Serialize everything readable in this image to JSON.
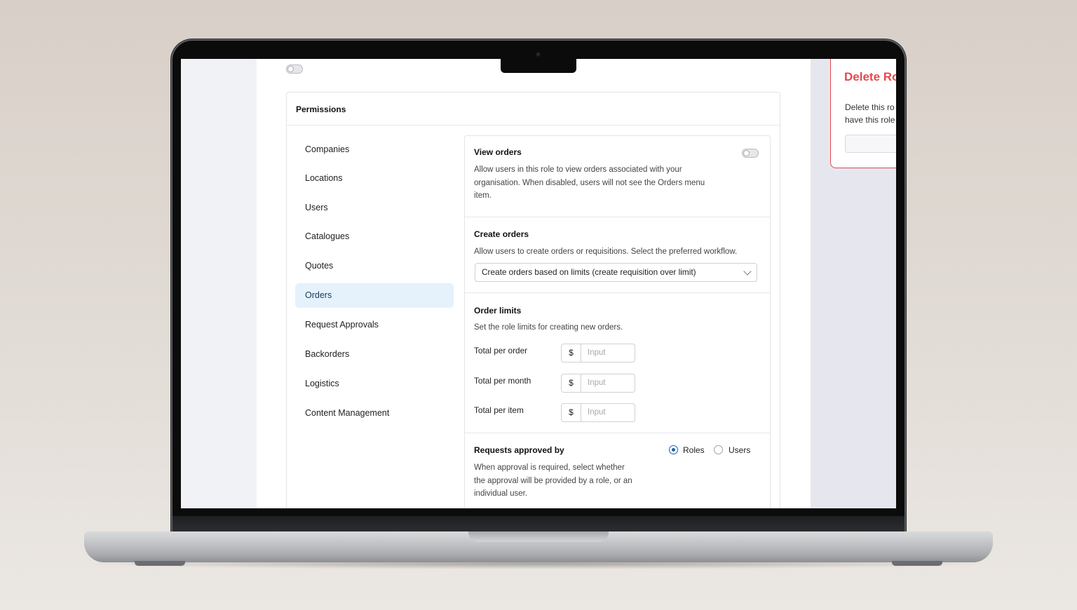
{
  "delete_panel": {
    "title": "Delete Ro",
    "text_line1": "Delete this ro",
    "text_line2": "have this role"
  },
  "permissions": {
    "title": "Permissions",
    "nav_items": [
      {
        "label": "Companies"
      },
      {
        "label": "Locations"
      },
      {
        "label": "Users"
      },
      {
        "label": "Catalogues"
      },
      {
        "label": "Quotes"
      },
      {
        "label": "Orders",
        "active": true
      },
      {
        "label": "Request Approvals"
      },
      {
        "label": "Backorders"
      },
      {
        "label": "Logistics"
      },
      {
        "label": "Content Management"
      }
    ]
  },
  "view_orders": {
    "title": "View orders",
    "enabled": false,
    "line1": "Allow users in this role to view orders associated with your",
    "line2": "organisation. When disabled, users will not see the Orders menu",
    "line3": "item."
  },
  "create_orders": {
    "title": "Create orders",
    "description": "Allow users to create orders or requisitions. Select the preferred workflow.",
    "selected_workflow": "Create orders based on limits (create requisition over limit)"
  },
  "order_limits": {
    "title": "Order limits",
    "description": "Set the role limits for creating new orders.",
    "currency_symbol": "$",
    "placeholder": "Input",
    "rows": [
      {
        "label": "Total per order"
      },
      {
        "label": "Total per month"
      },
      {
        "label": "Total per item"
      }
    ]
  },
  "requests_approved_by": {
    "title": "Requests approved by",
    "line1": "When approval is required, select whether",
    "line2": "the approval will be provided by a role, or an",
    "line3": "individual user.",
    "options": [
      "Roles",
      "Users"
    ],
    "selected": "Roles"
  }
}
